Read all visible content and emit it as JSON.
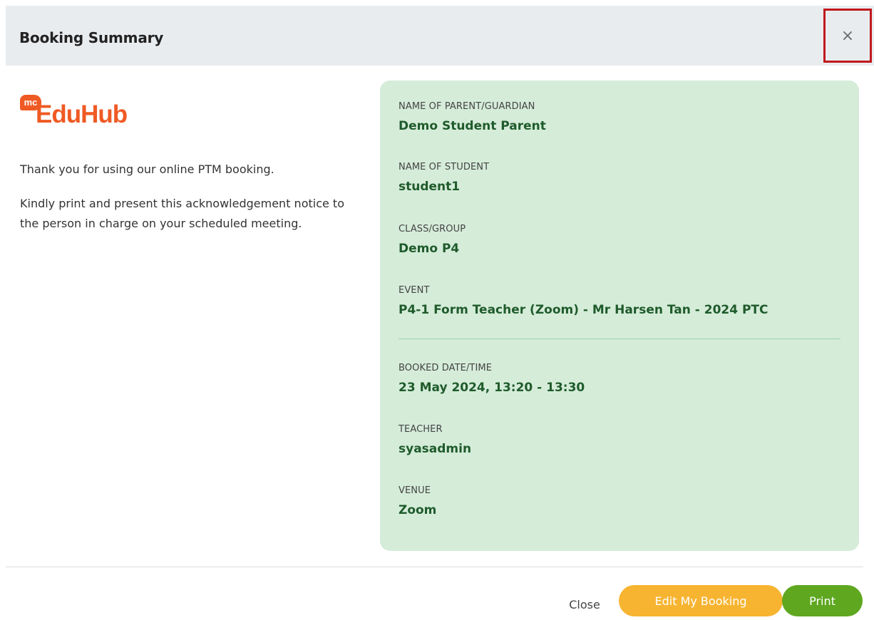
{
  "header": {
    "title": "Booking Summary",
    "close_symbol": "×"
  },
  "brand": {
    "badge": "mc",
    "name": "EduHub",
    "color": "#ef5a24"
  },
  "intro": {
    "line1": "Thank you for using our online PTM booking.",
    "line2": "Kindly print and present this acknowledgement notice to the person in charge on your scheduled meeting."
  },
  "summary": {
    "parent_label": "NAME OF PARENT/GUARDIAN",
    "parent_value": "Demo Student Parent",
    "student_label": "NAME OF STUDENT",
    "student_value": "student1",
    "class_label": "CLASS/GROUP",
    "class_value": "Demo P4",
    "event_label": "EVENT",
    "event_value": "P4-1 Form Teacher (Zoom) - Mr Harsen Tan - 2024 PTC",
    "booked_label": "BOOKED DATE/TIME",
    "booked_value": "23 May 2024, 13:20 - 13:30",
    "teacher_label": "TEACHER",
    "teacher_value": "syasadmin",
    "venue_label": "VENUE",
    "venue_value": "Zoom"
  },
  "footer": {
    "close_label": "Close",
    "edit_label": "Edit My Booking",
    "print_label": "Print"
  },
  "colors": {
    "card_bg": "#d5ecd9",
    "value_text": "#1f5b2b",
    "edit_button": "#f7b431",
    "print_button": "#5ea71f",
    "highlight_border": "#c0181c"
  }
}
